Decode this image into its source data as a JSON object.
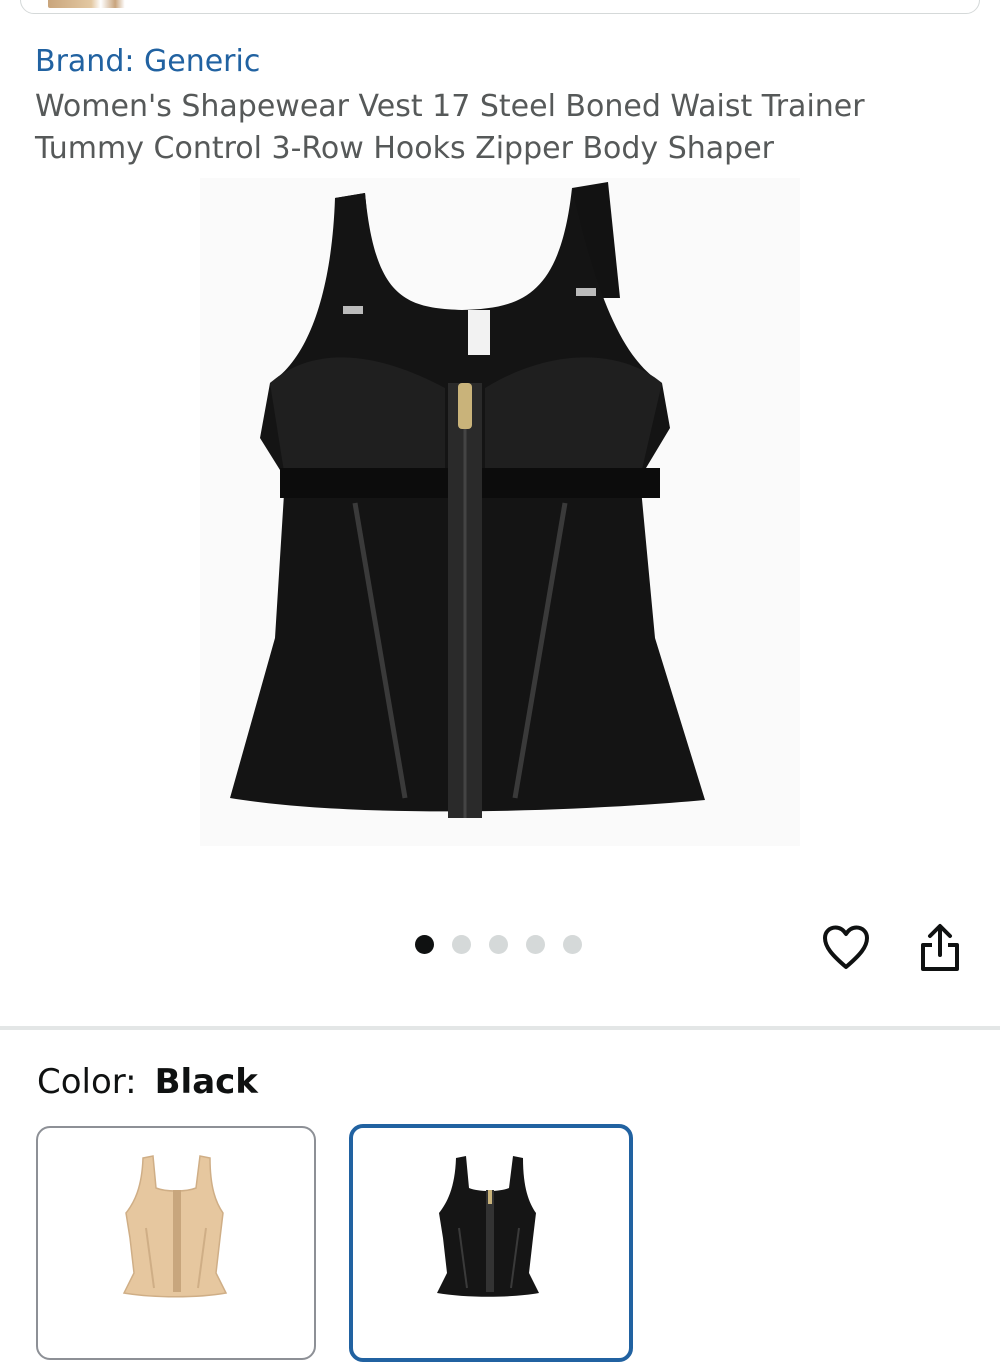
{
  "product": {
    "brand": "Brand: Generic",
    "title": "Women's Shapewear Vest 17 Steel Boned Waist Trainer Tummy Control 3-Row Hooks Zipper Body Shaper"
  },
  "gallery": {
    "image_count": 5,
    "active_index": 0,
    "image_alt": "black-zipper-shapewear-vest-photo"
  },
  "actions": {
    "wishlist_icon": "heart-outline-icon",
    "share_icon": "share-icon"
  },
  "variation": {
    "label": "Color:",
    "selected": "Black",
    "swatches": [
      {
        "name": "beige-vest-swatch",
        "color": "#e8c9a0",
        "selected": false
      },
      {
        "name": "black-vest-swatch",
        "color": "#111111",
        "selected": true
      }
    ]
  },
  "colors": {
    "link": "#2162a1",
    "text_secondary": "#565959",
    "selected_border": "#2162a1"
  }
}
